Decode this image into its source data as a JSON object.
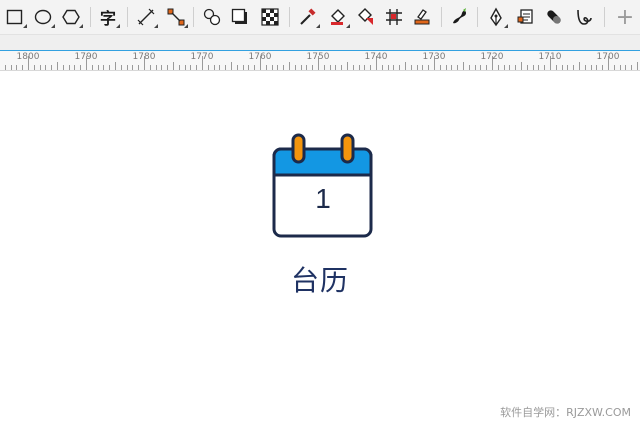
{
  "toolbar": {
    "tools": [
      {
        "name": "rectangle-tool",
        "icon": "rectangle-icon",
        "flyout": true
      },
      {
        "name": "ellipse-tool",
        "icon": "ellipse-icon",
        "flyout": true
      },
      {
        "name": "polygon-tool",
        "icon": "polygon-icon",
        "flyout": true
      },
      {
        "name": "text-tool",
        "icon": "text-icon",
        "glyph": "字",
        "flyout": true
      },
      {
        "name": "parallel-dimension-tool",
        "icon": "dimension-icon",
        "flyout": true
      },
      {
        "name": "connector-tool",
        "icon": "connector-icon",
        "flyout": true
      },
      {
        "name": "blend-tool",
        "icon": "blend-icon",
        "flyout": false
      },
      {
        "name": "drop-shadow-tool",
        "icon": "drop-shadow-icon",
        "flyout": false
      },
      {
        "name": "transparency-tool",
        "icon": "transparency-icon",
        "flyout": false
      },
      {
        "name": "color-eyedropper-tool",
        "icon": "eyedropper-icon",
        "flyout": true
      },
      {
        "name": "interactive-fill-tool",
        "icon": "fill-bucket-icon",
        "flyout": true
      },
      {
        "name": "smart-fill-tool",
        "icon": "smart-fill-icon",
        "flyout": false
      },
      {
        "name": "mesh-fill-tool",
        "icon": "mesh-fill-icon",
        "flyout": false
      },
      {
        "name": "outline-tool",
        "icon": "outline-pen-icon",
        "flyout": false
      },
      {
        "name": "artistic-media-tool",
        "icon": "artistic-media-icon",
        "flyout": false
      },
      {
        "name": "pen-tool",
        "icon": "pen-nib-icon",
        "flyout": true
      },
      {
        "name": "bezier-tool",
        "icon": "bezier-icon",
        "flyout": false
      },
      {
        "name": "smear-tool",
        "icon": "smear-icon",
        "flyout": false
      },
      {
        "name": "twirl-tool",
        "icon": "twirl-icon",
        "flyout": false
      }
    ],
    "add_button": "+"
  },
  "ruler": {
    "labels": [
      "1800",
      "1790",
      "1780",
      "1770",
      "1760",
      "1750",
      "1740",
      "1730",
      "1720",
      "1710",
      "1700"
    ],
    "accent_color": "#33a1e0"
  },
  "calendar": {
    "day_number": "1",
    "label": "台历",
    "header_color": "#1397e3",
    "ring_color": "#f4950d",
    "outline_color": "#1c2a4a"
  },
  "watermark": "软件自学网：RJZXW.COM"
}
